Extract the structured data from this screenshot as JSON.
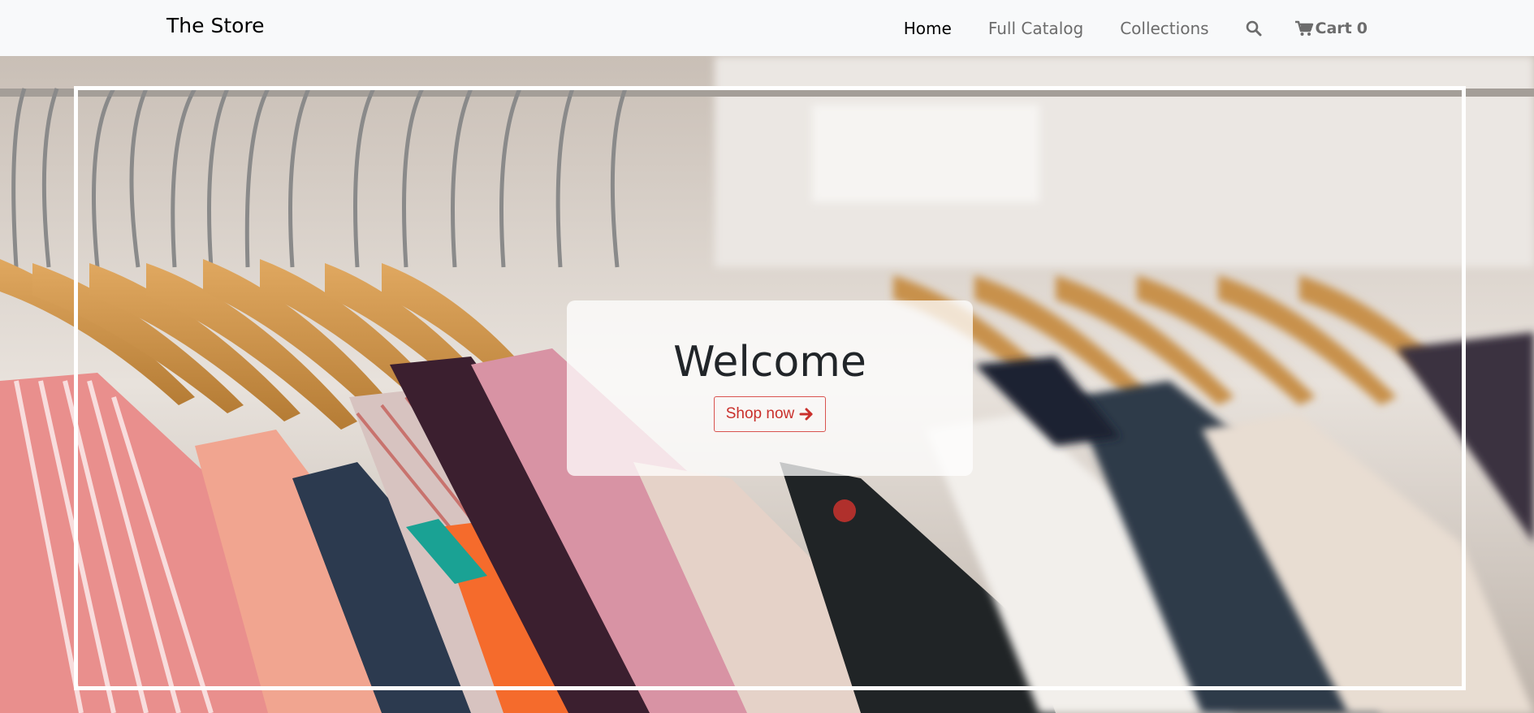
{
  "navbar": {
    "brand": "The Store",
    "links": [
      {
        "label": "Home",
        "active": true
      },
      {
        "label": "Full Catalog",
        "active": false
      },
      {
        "label": "Collections",
        "active": false
      }
    ],
    "search_icon": "search-icon",
    "cart": {
      "icon": "cart-icon",
      "label": "Cart",
      "count": "0"
    }
  },
  "hero": {
    "background": "clothing-rack-photo",
    "title": "Welcome",
    "button_label": "Shop now",
    "button_icon": "arrow-right-icon",
    "accent_color": "#dc3545"
  }
}
